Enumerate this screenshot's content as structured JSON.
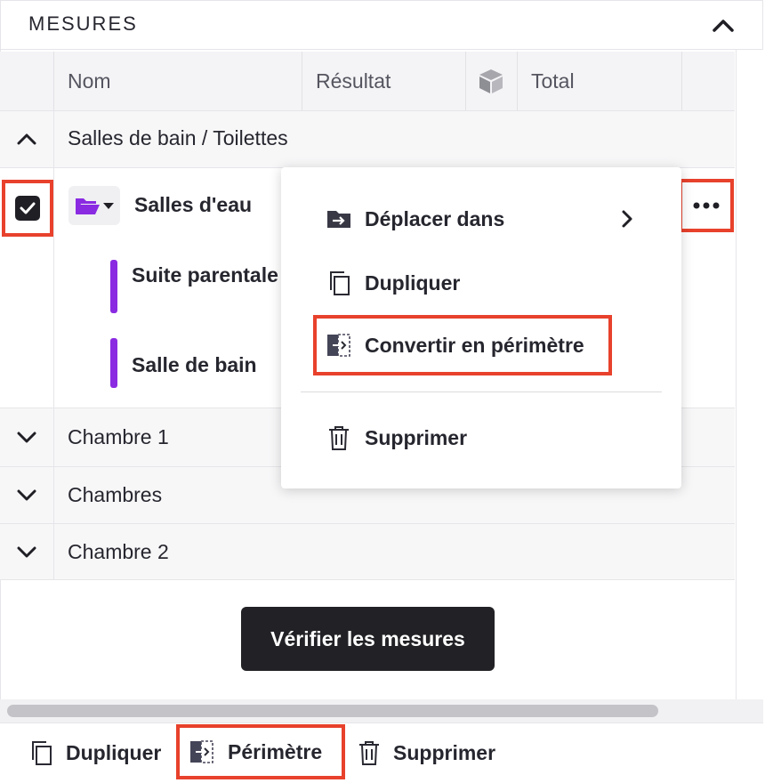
{
  "panel": {
    "title": "MESURES"
  },
  "table": {
    "columns": [
      "Nom",
      "Résultat",
      "Total"
    ],
    "column_icon": "cube-icon"
  },
  "groups": {
    "g0": {
      "label": "Salles de bain / Toilettes",
      "state": "expanded"
    },
    "g1": {
      "label": "Chambre 1",
      "state": "collapsed"
    },
    "g2": {
      "label": "Chambres",
      "state": "collapsed"
    },
    "g3": {
      "label": "Chambre 2",
      "state": "collapsed"
    }
  },
  "selected_item": {
    "label": "Salles d'eau",
    "checked": true,
    "children": [
      "Suite parentale",
      "Salle de bain"
    ]
  },
  "context_menu": {
    "move": "Déplacer dans",
    "duplicate": "Dupliquer",
    "convert": "Convertir en périmètre",
    "delete": "Supprimer"
  },
  "verify_button": "Vérifier les mesures",
  "bottom_bar": {
    "duplicate": "Dupliquer",
    "perimeter": "Périmètre",
    "delete": "Supprimer"
  },
  "colors": {
    "highlight": "#e8412c",
    "accent_purple": "#8a2be2",
    "dark": "#222226"
  }
}
